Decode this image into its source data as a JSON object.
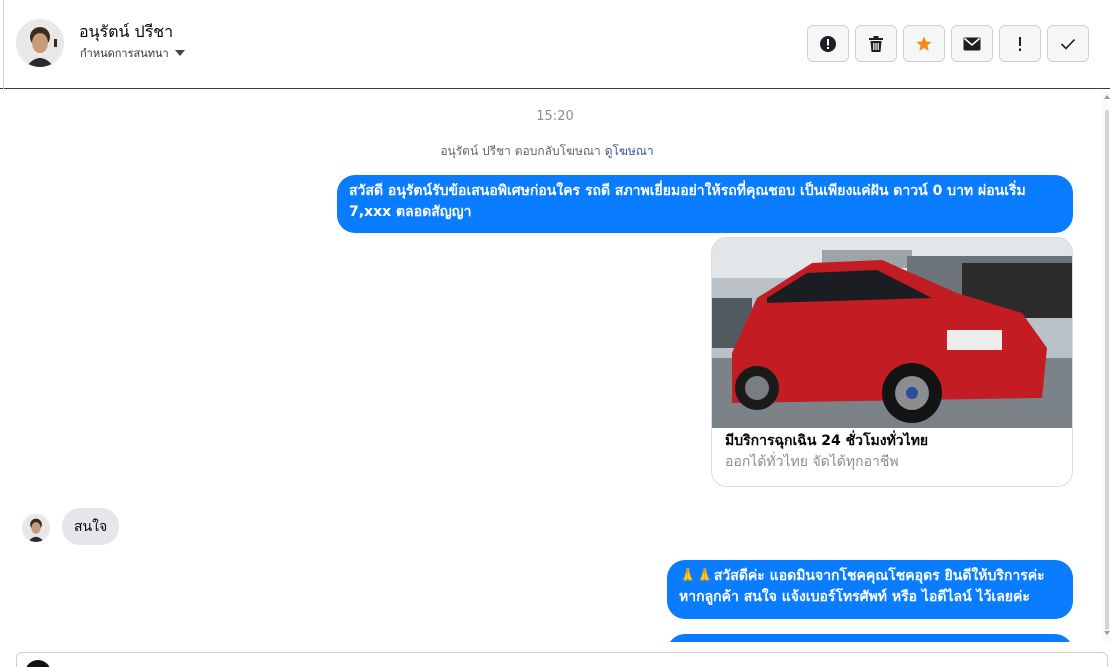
{
  "header": {
    "contact_name": "อนุรัตน์ ปรีชา",
    "label_text": "กำหนดการสนทนา"
  },
  "toolbar": {
    "buttons": [
      {
        "name": "alert-circle-icon"
      },
      {
        "name": "trash-icon"
      },
      {
        "name": "star-icon",
        "color": "#f28a1e"
      },
      {
        "name": "envelope-icon"
      },
      {
        "name": "exclamation-icon"
      },
      {
        "name": "check-icon"
      }
    ]
  },
  "chat": {
    "timestamp": "15:20",
    "ad_reply": {
      "text": "อนุรัตน์ ปรีชา ตอบกลับโฆษณา",
      "link": "ดูโฆษณา"
    },
    "messages": [
      {
        "direction": "out",
        "text": "สวัสดี อนุรัตน์รับข้อเสนอพิเศษก่อนใคร รถดี สภาพเยี่ยมอย่าให้รถที่คุณชอบ เป็นเพียงแค่ฝัน ดาวน์ 0 บาท ผ่อนเริ่ม 7,xxx ตลอดสัญญา"
      },
      {
        "direction": "in",
        "text": "สนใจ"
      },
      {
        "direction": "out",
        "text": "🙏🙏สวัสดีค่ะ แอดมินจากโชคคุณโชคอุดร ยินดีให้บริการค่ะ หากลูกค้า สนใจ แจ้งเบอร์โทรศัพท์ หรือ ไอดีไลน์  ไว้เลยค่ะ"
      }
    ],
    "ad_card": {
      "title": "มีบริการฉุกเฉิน 24 ชั่วโมงทั่วไทย",
      "subtitle": "ออกได้ทั่วไทย จัดได้ทุกอาชีพ"
    }
  },
  "colors": {
    "outgoing_bubble": "#0a7cff",
    "incoming_bubble": "#e4e6eb",
    "link": "#385898"
  }
}
